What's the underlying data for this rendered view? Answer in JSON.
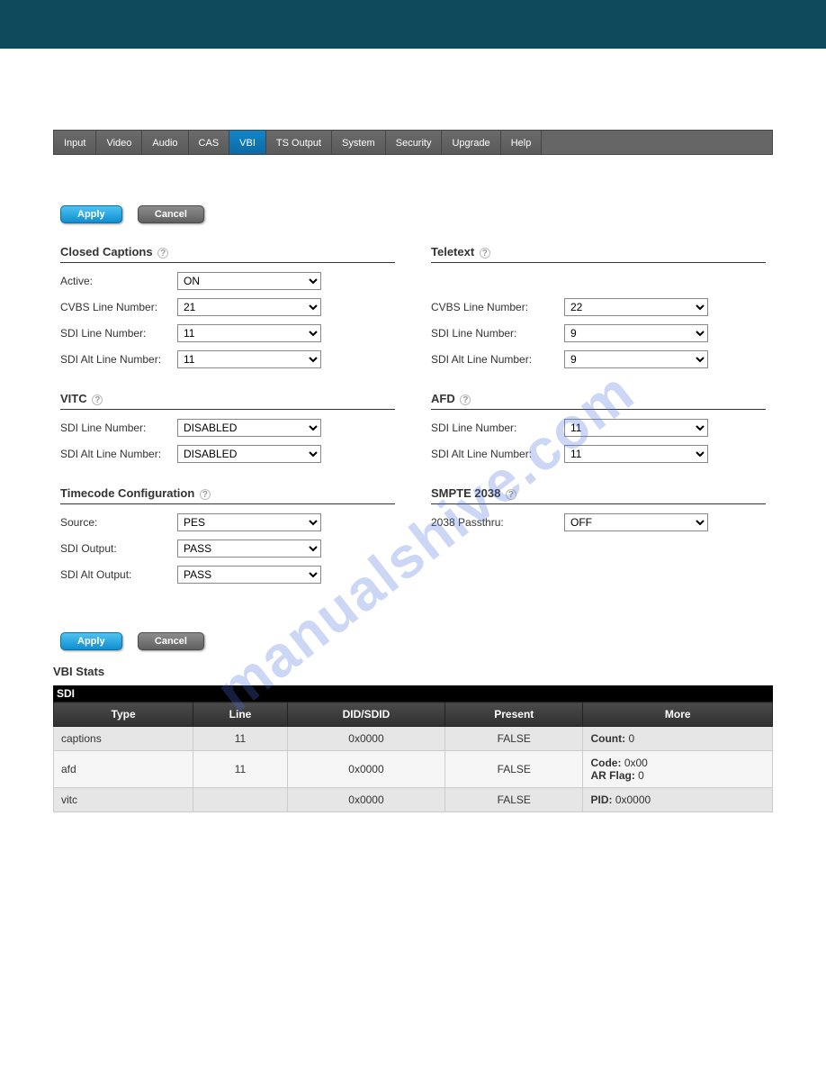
{
  "nav": {
    "items": [
      "Input",
      "Video",
      "Audio",
      "CAS",
      "VBI",
      "TS Output",
      "System",
      "Security",
      "Upgrade",
      "Help"
    ],
    "active": "VBI"
  },
  "buttons": {
    "apply": "Apply",
    "cancel": "Cancel"
  },
  "sections": {
    "closed_captions": {
      "title": "Closed Captions",
      "fields": {
        "active": {
          "label": "Active:",
          "value": "ON"
        },
        "cvbs_line": {
          "label": "CVBS Line Number:",
          "value": "21"
        },
        "sdi_line": {
          "label": "SDI Line Number:",
          "value": "11"
        },
        "sdi_alt_line": {
          "label": "SDI Alt Line Number:",
          "value": "11"
        }
      }
    },
    "teletext": {
      "title": "Teletext",
      "fields": {
        "cvbs_line": {
          "label": "CVBS Line Number:",
          "value": "22"
        },
        "sdi_line": {
          "label": "SDI Line Number:",
          "value": "9"
        },
        "sdi_alt_line": {
          "label": "SDI Alt Line Number:",
          "value": "9"
        }
      }
    },
    "vitc": {
      "title": "VITC",
      "fields": {
        "sdi_line": {
          "label": "SDI Line Number:",
          "value": "DISABLED"
        },
        "sdi_alt_line": {
          "label": "SDI Alt Line Number:",
          "value": "DISABLED"
        }
      }
    },
    "afd": {
      "title": "AFD",
      "fields": {
        "sdi_line": {
          "label": "SDI Line Number:",
          "value": "11"
        },
        "sdi_alt_line": {
          "label": "SDI Alt Line Number:",
          "value": "11"
        }
      }
    },
    "timecode": {
      "title": "Timecode Configuration",
      "fields": {
        "source": {
          "label": "Source:",
          "value": "PES"
        },
        "sdi_output": {
          "label": "SDI Output:",
          "value": "PASS"
        },
        "sdi_alt_output": {
          "label": "SDI Alt Output:",
          "value": "PASS"
        }
      }
    },
    "smpte2038": {
      "title": "SMPTE 2038",
      "fields": {
        "passthru": {
          "label": "2038 Passthru:",
          "value": "OFF"
        }
      }
    }
  },
  "stats": {
    "title": "VBI Stats",
    "table_caption": "SDI",
    "headers": [
      "Type",
      "Line",
      "DID/SDID",
      "Present",
      "More"
    ],
    "rows": [
      {
        "type": "captions",
        "line": "11",
        "didsdid": "0x0000",
        "present": "FALSE",
        "more": [
          {
            "label": "Count:",
            "value": "0"
          }
        ]
      },
      {
        "type": "afd",
        "line": "11",
        "didsdid": "0x0000",
        "present": "FALSE",
        "more": [
          {
            "label": "Code:",
            "value": "0x00"
          },
          {
            "label": "AR Flag:",
            "value": "0"
          }
        ]
      },
      {
        "type": "vitc",
        "line": "",
        "didsdid": "0x0000",
        "present": "FALSE",
        "more": [
          {
            "label": "PID:",
            "value": "0x0000"
          }
        ]
      }
    ]
  },
  "watermark": "manualshive.com"
}
